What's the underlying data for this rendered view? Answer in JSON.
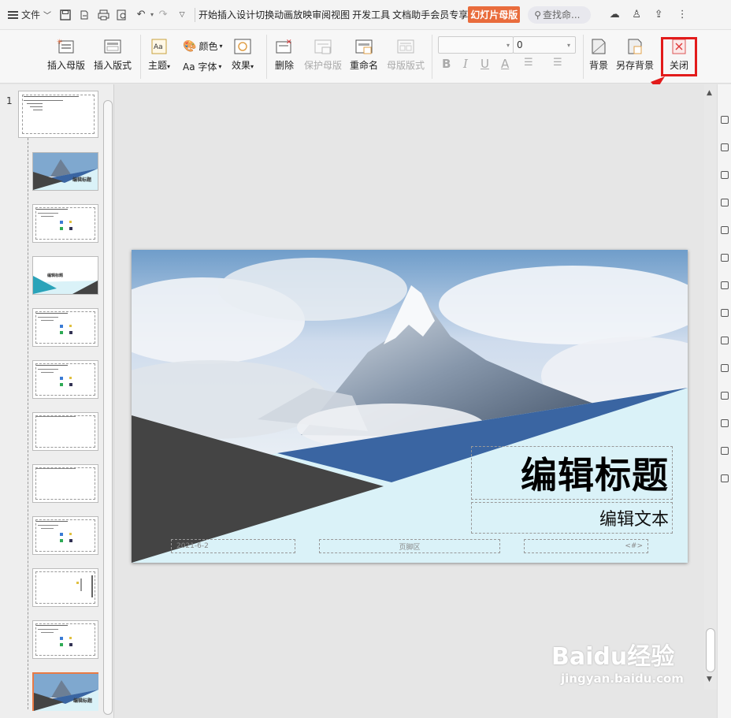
{
  "menubar": {
    "file_label": "文件",
    "tabs": [
      "开始",
      "插入",
      "设计",
      "切换",
      "动画",
      "放映",
      "审阅",
      "视图",
      "开发工具",
      "文档助手",
      "会员专享"
    ],
    "active_tab": "幻灯片母版",
    "search_placeholder": "查找命..."
  },
  "ribbon": {
    "insert_master": "插入母版",
    "insert_layout": "插入版式",
    "theme": "主题",
    "colors": "颜色",
    "fonts": "Aa 字体",
    "effects": "效果",
    "delete": "删除",
    "protect_master": "保护母版",
    "rename": "重命名",
    "master_layout": "母版版式",
    "font_size_value": "0",
    "background": "背景",
    "save_background": "另存背景",
    "close": "关闭"
  },
  "thumbs": {
    "master_number": "1",
    "count": 12,
    "thumb_title": "编辑标题",
    "thumb_sub": "编辑文本"
  },
  "slide": {
    "title": "编辑标题",
    "subtitle": "编辑文本",
    "date": "2021-6-2",
    "footer": "页脚区",
    "page_num": "<#>",
    "colors": {
      "dark": "#444444",
      "blue": "#3a65a2",
      "light": "#daf2f8",
      "sky": "#7fa8cf"
    }
  },
  "watermark": {
    "brand": "Baidu经验",
    "url": "jingyan.baidu.com"
  },
  "colors": {
    "accent": "#e96c3c",
    "highlight": "#e21b1b"
  }
}
